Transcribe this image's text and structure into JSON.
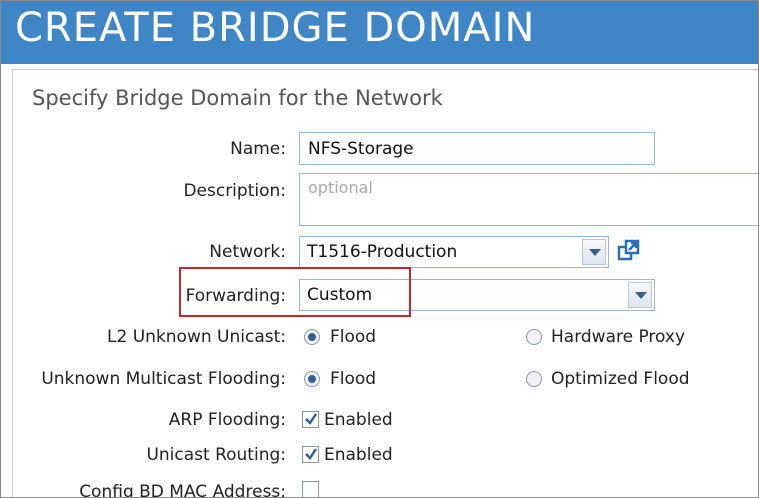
{
  "window": {
    "title": "CREATE BRIDGE DOMAIN"
  },
  "panel": {
    "subtitle": "Specify Bridge Domain for the Network"
  },
  "form": {
    "name": {
      "label": "Name:",
      "value": "NFS-Storage"
    },
    "description": {
      "label": "Description:",
      "placeholder": "optional"
    },
    "network": {
      "label": "Network:",
      "value": "T1516-Production",
      "icon": "open-external-icon"
    },
    "forwarding": {
      "label": "Forwarding:",
      "value": "Custom"
    },
    "l2_unknown_unicast": {
      "label": "L2 Unknown Unicast:",
      "options": [
        "Flood",
        "Hardware Proxy"
      ],
      "selected": "Flood"
    },
    "unknown_multicast_flooding": {
      "label": "Unknown Multicast Flooding:",
      "options": [
        "Flood",
        "Optimized Flood"
      ],
      "selected": "Flood"
    },
    "arp_flooding": {
      "label": "ARP Flooding:",
      "checked": true,
      "option_label": "Enabled"
    },
    "unicast_routing": {
      "label": "Unicast Routing:",
      "checked": true,
      "option_label": "Enabled"
    },
    "config_bd_mac": {
      "label": "Config BD MAC Address:",
      "checked": false
    }
  },
  "colors": {
    "title_bar": "#3e86c6",
    "highlight_box": "#c0282d",
    "radio_dot": "#2f5f95"
  }
}
